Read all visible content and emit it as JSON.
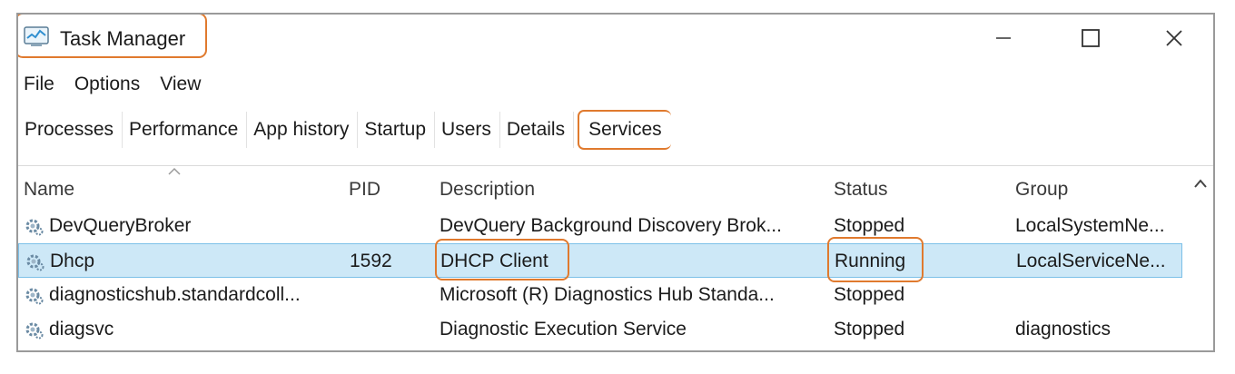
{
  "window": {
    "title": "Task Manager",
    "controls": {
      "minimize_icon": "minimize-icon",
      "maximize_icon": "maximize-icon",
      "close_icon": "close-icon"
    }
  },
  "menu": [
    "File",
    "Options",
    "View"
  ],
  "tabs": [
    {
      "label": "Processes",
      "active": false
    },
    {
      "label": "Performance",
      "active": false
    },
    {
      "label": "App history",
      "active": false
    },
    {
      "label": "Startup",
      "active": false
    },
    {
      "label": "Users",
      "active": false
    },
    {
      "label": "Details",
      "active": false
    },
    {
      "label": "Services",
      "active": true
    }
  ],
  "columns": {
    "name": "Name",
    "pid": "PID",
    "description": "Description",
    "status": "Status",
    "group": "Group"
  },
  "services": [
    {
      "name": "DevQueryBroker",
      "pid": "",
      "description": "DevQuery Background Discovery Brok...",
      "status": "Stopped",
      "group": "LocalSystemNe...",
      "selected": false
    },
    {
      "name": "Dhcp",
      "pid": "1592",
      "description": "DHCP Client",
      "status": "Running",
      "group": "LocalServiceNe...",
      "selected": true
    },
    {
      "name": "diagnosticshub.standardcoll...",
      "pid": "",
      "description": "Microsoft (R) Diagnostics Hub Standa...",
      "status": "Stopped",
      "group": "",
      "selected": false
    },
    {
      "name": "diagsvc",
      "pid": "",
      "description": "Diagnostic Execution Service",
      "status": "Stopped",
      "group": "diagnostics",
      "selected": false
    }
  ],
  "colors": {
    "highlight_annotation": "#e07a2e",
    "selected_row_bg": "#cde8f7",
    "selected_row_border": "#7cc0e8"
  }
}
